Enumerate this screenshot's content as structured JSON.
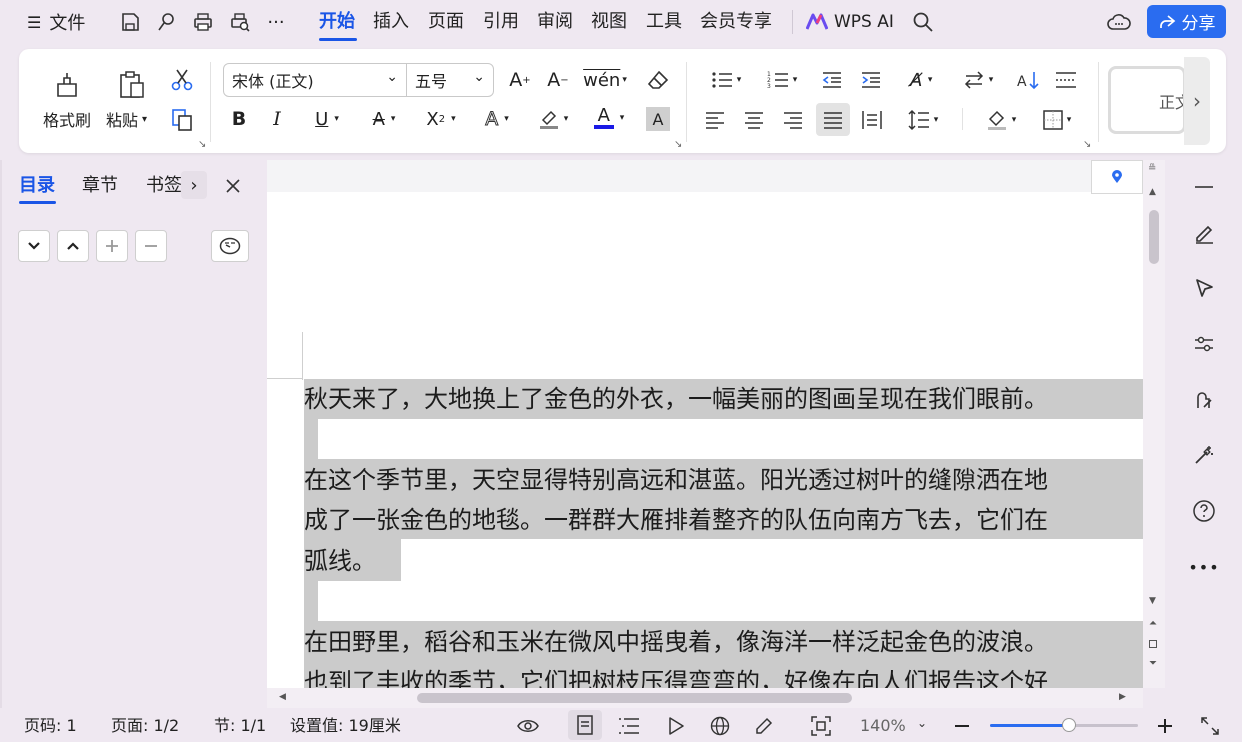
{
  "menubar": {
    "file_label": "文件",
    "tabs": [
      {
        "label": "开始",
        "active": true
      },
      {
        "label": "插入"
      },
      {
        "label": "页面"
      },
      {
        "label": "引用"
      },
      {
        "label": "审阅"
      },
      {
        "label": "视图"
      },
      {
        "label": "工具"
      },
      {
        "label": "会员专享"
      }
    ],
    "wps_ai_label": "WPS AI",
    "share_label": "分享",
    "accent_color": "#1a55e6"
  },
  "ribbon": {
    "format_painter_label": "格式刷",
    "paste_label": "粘贴",
    "font_name": "宋体 (正文)",
    "font_size": "五号",
    "style_preview": "正文",
    "font_color": "#1a1ae6"
  },
  "nav": {
    "tabs": [
      "目录",
      "章节",
      "书签"
    ]
  },
  "document": {
    "lines": [
      "秋天来了，大地换上了金色的外衣，一幅美丽的图画呈现在我们眼前。",
      "",
      "在这个季节里，天空显得特别高远和湛蓝。阳光透过树叶的缝隙洒在地",
      "成了一张金色的地毯。一群群大雁排着整齐的队伍向南方飞去，它们在",
      "弧线。",
      "",
      "在田野里，稻谷和玉米在微风中摇曳着，像海洋一样泛起金色的波浪。",
      "也到了丰收的季节，它们把树枝压得弯弯的，好像在向人们报告这个好"
    ]
  },
  "status": {
    "page_code": "页码: 1",
    "page": "页面: 1/2",
    "section": "节: 1/1",
    "setting": "设置值: 19厘米",
    "zoom": "140%"
  }
}
